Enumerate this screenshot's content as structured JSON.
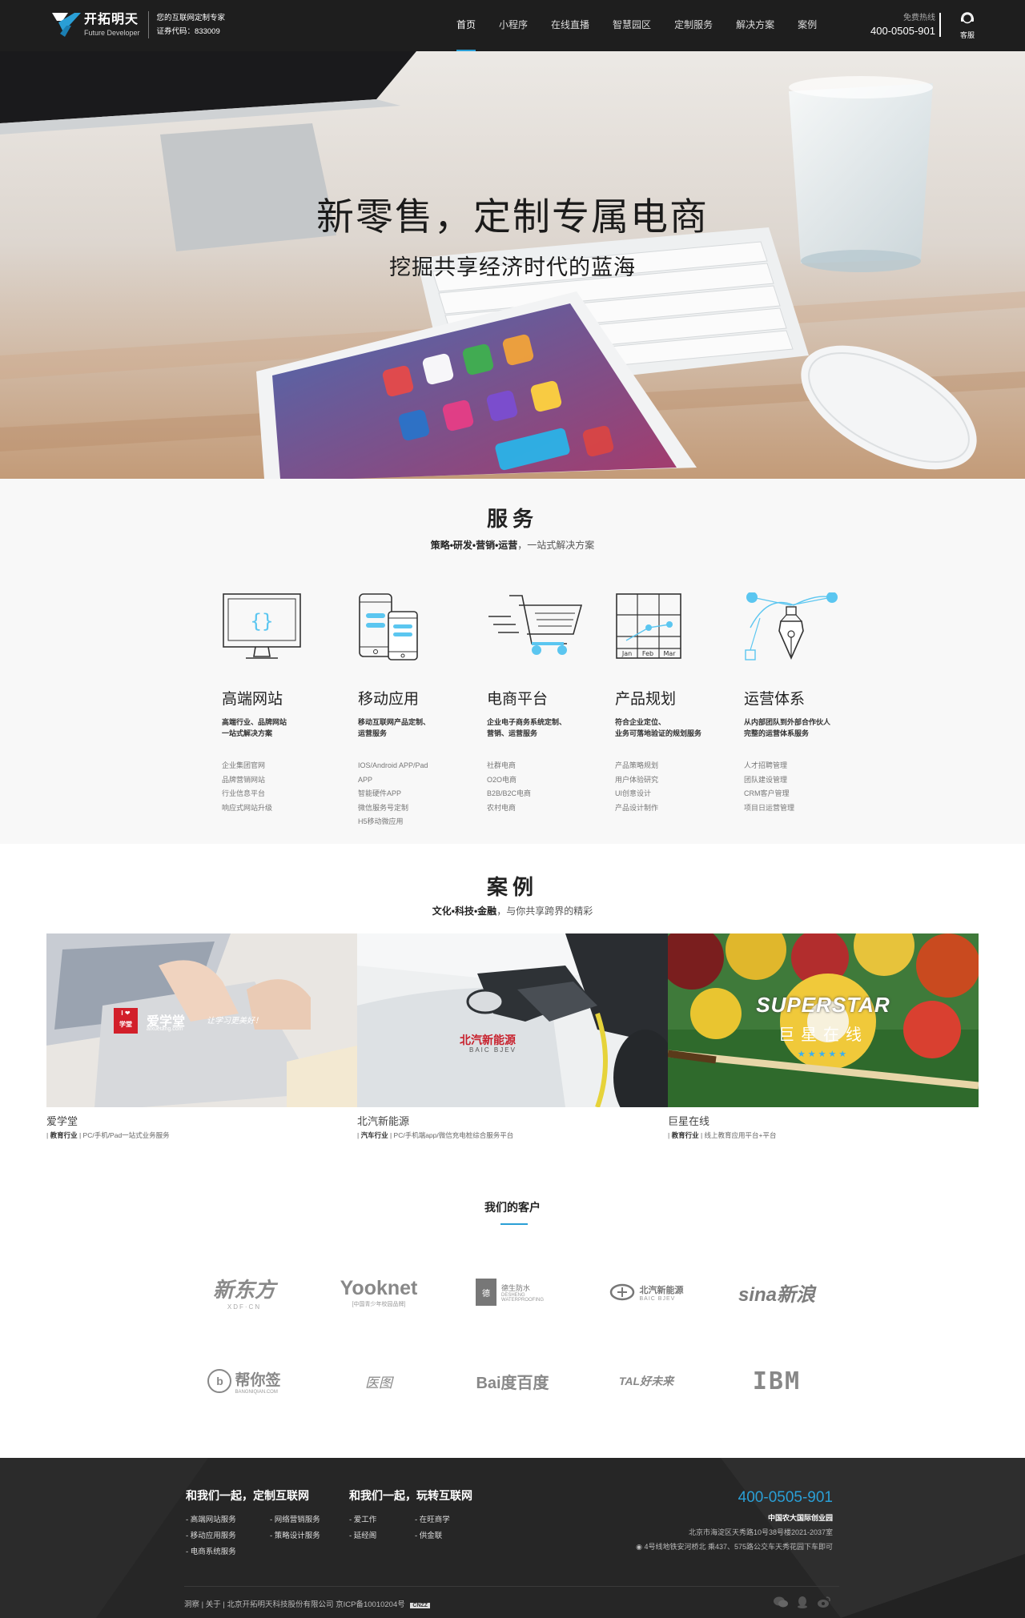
{
  "header": {
    "logo_cn": "开拓明天",
    "logo_en": "Future Developer",
    "slogan": "您的互联网定制专家",
    "stock_code": "证券代码：833009",
    "nav": [
      "首页",
      "小程序",
      "在线直播",
      "智慧园区",
      "定制服务",
      "解决方案",
      "案例"
    ],
    "hotline_label": "免费热线",
    "hotline_number": "400-0505-901",
    "service_label": "客服"
  },
  "hero": {
    "title": "新零售，定制专属电商",
    "subtitle": "挖掘共享经济时代的蓝海"
  },
  "services": {
    "title": "服务",
    "subtitle_bold": "策略•研发•营销•运营",
    "subtitle_rest": "，一站式解决方案",
    "items": [
      {
        "icon": "monitor-code-icon",
        "name": "高端网站",
        "desc": "高端行业、品牌网站\n一站式解决方案",
        "list": [
          "企业集团官网",
          "品牌营销网站",
          "行业信息平台",
          "响应式网站升级"
        ]
      },
      {
        "icon": "mobile-devices-icon",
        "name": "移动应用",
        "desc": "移动互联网产品定制、\n运营服务",
        "list": [
          "IOS/Android APP/Pad",
          "APP",
          "智能硬件APP",
          "微信服务号定制",
          "H5移动微应用"
        ]
      },
      {
        "icon": "shopping-cart-icon",
        "name": "电商平台",
        "desc": "企业电子商务系统定制、\n营销、运营服务",
        "list": [
          "社群电商",
          "O2O电商",
          "B2B/B2C电商",
          "农村电商"
        ]
      },
      {
        "icon": "calendar-plan-icon",
        "name": "产品规划",
        "desc": "符合企业定位、\n业务可落地验证的规划服务",
        "list": [
          "产品策略规划",
          "用户体验研究",
          "UI创意设计",
          "产品设计制作"
        ]
      },
      {
        "icon": "pen-tool-icon",
        "name": "运营体系",
        "desc": "从内部团队到外部合作伙人\n完整的运营体系服务",
        "list": [
          "人才招聘管理",
          "团队建设管理",
          "CRM客户管理",
          "项目日运营管理"
        ]
      }
    ],
    "calendar_labels": [
      "Jan",
      "Feb",
      "Mar"
    ]
  },
  "cases": {
    "title": "案例",
    "subtitle_bold": "文化•科技•金融",
    "subtitle_rest": "，与你共享跨界的精彩",
    "items": [
      {
        "name": "爱学堂",
        "tag_bold": "教育行业",
        "tag_rest": "PC/手机/Pad一站式业务服务",
        "logo_text": "爱学堂",
        "logo_slogan": "让学习更美好！",
        "logo_url": "aixuetang.com",
        "badge_top": "I ❤",
        "badge_bottom": "学堂"
      },
      {
        "name": "北汽新能源",
        "tag_bold": "汽车行业",
        "tag_rest": "PC/手机端app/微信充电桩综合服务平台",
        "logo_text": "北汽新能源",
        "logo_sub": "BAIC BJEV"
      },
      {
        "name": "巨星在线",
        "tag_bold": "教育行业",
        "tag_rest": "线上教育应用平台+平台",
        "logo_text": "SUPERSTAR",
        "logo_sub": "巨星在线",
        "stars": "★★★★★"
      }
    ]
  },
  "clients": {
    "title": "我们的客户",
    "items": [
      {
        "name": "新东方",
        "sub": "XDF·CN"
      },
      {
        "name": "Yooknet",
        "sub": "[中国青少年校园品牌]"
      },
      {
        "name": "德生防水",
        "sub": "DESHENG WATERPROOFING"
      },
      {
        "name": "北汽新能源",
        "sub": "BAIC BJEV"
      },
      {
        "name": "sina新浪",
        "sub": ""
      },
      {
        "name": "帮你签",
        "sub": "BANGNIQIAN.COM"
      },
      {
        "name": "医图",
        "sub": ""
      },
      {
        "name": "Bai度百度",
        "sub": ""
      },
      {
        "name": "TAL好未来",
        "sub": ""
      },
      {
        "name": "IBM",
        "sub": ""
      }
    ]
  },
  "footer": {
    "col1_title": "和我们一起，定制互联网",
    "col1_links": [
      "- 高端网站服务",
      "- 网络营销服务",
      "- 移动应用服务",
      "- 策略设计服务",
      "- 电商系统服务"
    ],
    "col2_title": "和我们一起，玩转互联网",
    "col2_links": [
      "- 爱工作",
      "- 在旺商学",
      "- 延经阁",
      "- 供金联"
    ],
    "phone": "400-0505-901",
    "location": "中国农大国际创业园",
    "address": "北京市海淀区天秀路10号38号楼2021-2037室",
    "transit": "4号线地铁安河桥北  乘437、575路公交车天秀花园下车即可",
    "copyright": "洞察 | 关于 | 北京开拓明天科技股份有限公司 京ICP备10010204号",
    "cnzz_badge": "CNZZ"
  },
  "colors": {
    "accent": "#2a9fd6",
    "header_bg": "#1e1e1e",
    "footer_bg": "#262626",
    "icon_blue": "#5bc6f0"
  }
}
